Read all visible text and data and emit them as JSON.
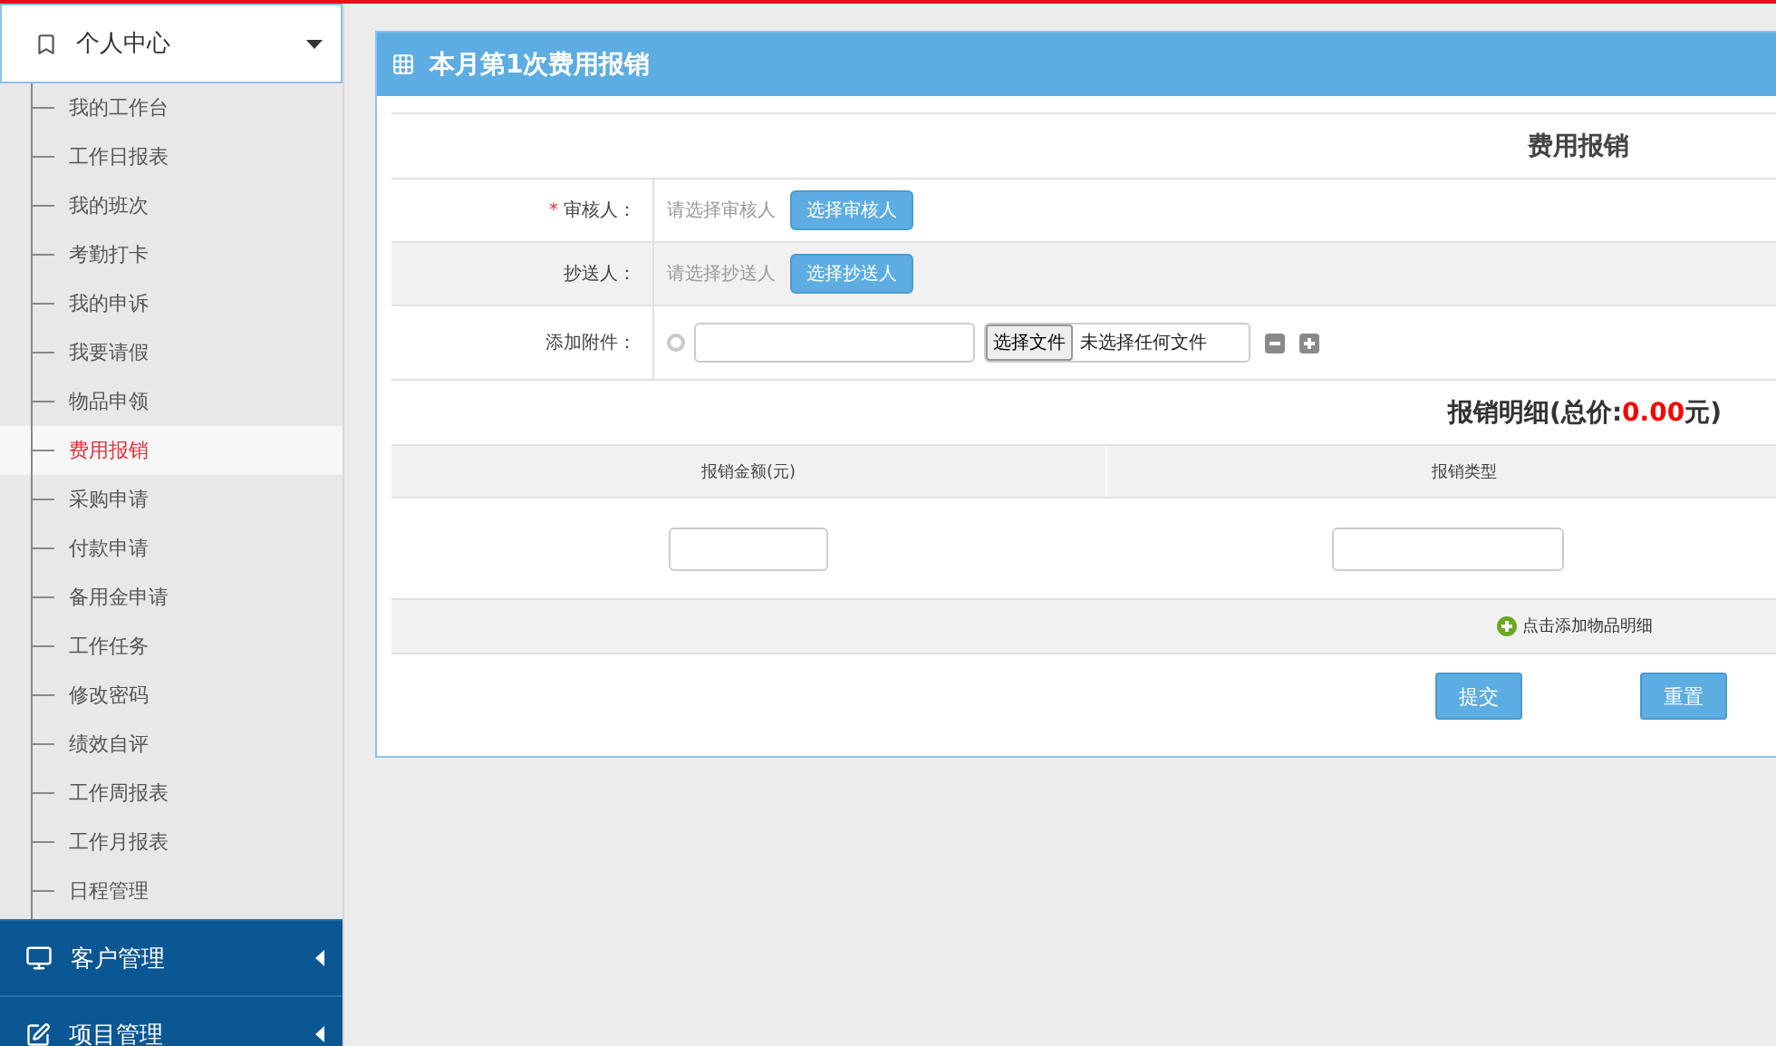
{
  "sidebar": {
    "header": {
      "label": "个人中心",
      "expanded": true
    },
    "items": [
      {
        "label": "我的工作台",
        "selected": false
      },
      {
        "label": "工作日报表",
        "selected": false
      },
      {
        "label": "我的班次",
        "selected": false
      },
      {
        "label": "考勤打卡",
        "selected": false
      },
      {
        "label": "我的申诉",
        "selected": false
      },
      {
        "label": "我要请假",
        "selected": false
      },
      {
        "label": "物品申领",
        "selected": false
      },
      {
        "label": "费用报销",
        "selected": true
      },
      {
        "label": "采购申请",
        "selected": false
      },
      {
        "label": "付款申请",
        "selected": false
      },
      {
        "label": "备用金申请",
        "selected": false
      },
      {
        "label": "工作任务",
        "selected": false
      },
      {
        "label": "修改密码",
        "selected": false
      },
      {
        "label": "绩效自评",
        "selected": false
      },
      {
        "label": "工作周报表",
        "selected": false
      },
      {
        "label": "工作月报表",
        "selected": false
      },
      {
        "label": "日程管理",
        "selected": false
      }
    ],
    "sections": [
      {
        "label": "客户管理",
        "kind": "monitor",
        "expanded": false
      },
      {
        "label": "项目管理",
        "kind": "edit",
        "expanded": false
      }
    ]
  },
  "panel": {
    "title": "本月第1次费用报销",
    "form": {
      "heading": "费用报销",
      "fields": [
        {
          "kind": "picker",
          "label": "审核人：",
          "required_mark": "*",
          "placeholder": "请选择审核人",
          "button": "选择审核人"
        },
        {
          "kind": "picker",
          "label": "抄送人：",
          "placeholder": "请选择抄送人",
          "button": "选择抄送人"
        },
        {
          "kind": "file",
          "label": "添加附件：",
          "file_button": "选择文件",
          "file_status": "未选择任何文件"
        }
      ]
    },
    "details": {
      "title": "报销明细(总价:",
      "total": "0.00",
      "title_end": "元)",
      "columns": [
        "报销金额(元)",
        "报销类型"
      ],
      "add_link": "点击添加物品明细"
    },
    "buttons": [
      "提交",
      "重置"
    ]
  }
}
